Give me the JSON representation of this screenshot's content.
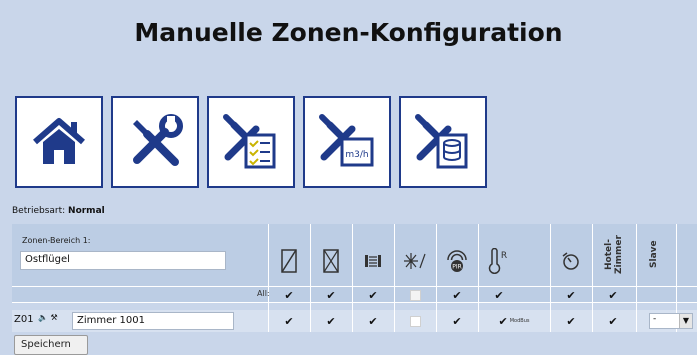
{
  "page": {
    "title": "Manuelle Zonen-Konfiguration"
  },
  "nav": [
    {
      "icon": "home-icon"
    },
    {
      "icon": "tools-icon"
    },
    {
      "icon": "tools-checklist-icon"
    },
    {
      "icon": "tools-airflow-icon"
    },
    {
      "icon": "tools-database-icon"
    }
  ],
  "mode": {
    "label": "Betriebsart:",
    "value": "Normal"
  },
  "zone_area": {
    "label": "Zonen-Bereich 1:",
    "value": "Ostflügel"
  },
  "columns": [
    {
      "icon": "window-open-icon"
    },
    {
      "icon": "window-closed-icon"
    },
    {
      "icon": "blind-icon"
    },
    {
      "icon": "frost-icon"
    },
    {
      "icon": "pir-sensor-icon",
      "text": "PIR"
    },
    {
      "icon": "thermometer-icon",
      "text": "R"
    },
    {
      "icon": "timer-icon"
    },
    {
      "text": "Hotel-Zimmer"
    },
    {
      "text": "Slave"
    }
  ],
  "all_row": {
    "label": "All:",
    "checks": [
      true,
      true,
      true,
      false,
      true,
      true,
      true,
      true
    ]
  },
  "row": {
    "zone": "Z01",
    "name": "Zimmer 1001",
    "checks": [
      true,
      true,
      true,
      false,
      true,
      true,
      true,
      true
    ],
    "modbus": "ModBus",
    "slave": "-"
  },
  "save_label": "Speichern",
  "colors": {
    "border": "#1f3a8a",
    "background": "#c9d6ea"
  }
}
